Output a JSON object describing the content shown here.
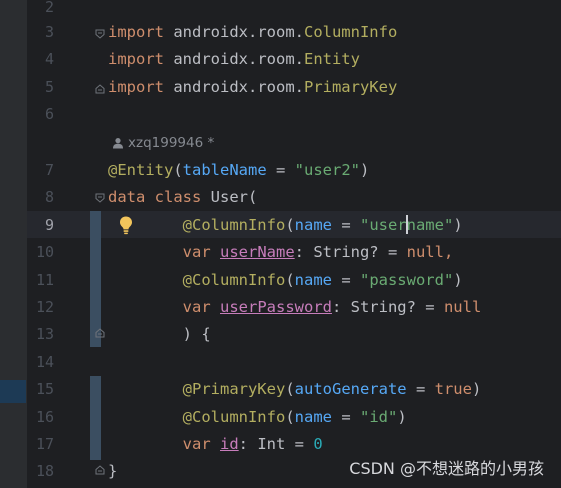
{
  "editor": {
    "author": "xzq199946 *",
    "lines": [
      {
        "number": "2",
        "tokens": []
      },
      {
        "number": "3",
        "tokens": [
          {
            "t": "import",
            "c": "kw"
          },
          {
            "t": " androidx.room."
          },
          {
            "t": "ColumnInfo",
            "c": "ann"
          }
        ]
      },
      {
        "number": "4",
        "tokens": [
          {
            "t": "import",
            "c": "kw"
          },
          {
            "t": " androidx.room."
          },
          {
            "t": "Entity",
            "c": "ann"
          }
        ]
      },
      {
        "number": "5",
        "tokens": [
          {
            "t": "import",
            "c": "kw"
          },
          {
            "t": " androidx.room."
          },
          {
            "t": "PrimaryKey",
            "c": "ann"
          }
        ]
      },
      {
        "number": "6",
        "tokens": []
      },
      {
        "number": "7",
        "tokens": [
          {
            "t": "@Entity",
            "c": "ann"
          },
          {
            "t": "("
          },
          {
            "t": "tableName",
            "c": "param"
          },
          {
            "t": " = "
          },
          {
            "t": "\"user2\"",
            "c": "str"
          },
          {
            "t": ")"
          }
        ]
      },
      {
        "number": "8",
        "tokens": [
          {
            "t": "data class",
            "c": "kw"
          },
          {
            "t": " User("
          }
        ]
      },
      {
        "number": "9",
        "tokens": [
          {
            "t": "        "
          },
          {
            "t": "@ColumnInfo",
            "c": "ann"
          },
          {
            "t": "("
          },
          {
            "t": "name",
            "c": "param"
          },
          {
            "t": " = "
          },
          {
            "t": "\"username\"",
            "c": "str"
          },
          {
            "t": ")"
          }
        ]
      },
      {
        "number": "10",
        "tokens": [
          {
            "t": "        "
          },
          {
            "t": "var",
            "c": "kw"
          },
          {
            "t": " "
          },
          {
            "t": "userName",
            "c": "prop"
          },
          {
            "t": ": String? = "
          },
          {
            "t": "null",
            "c": "kw"
          },
          {
            "t": ",",
            "c": "kw"
          }
        ]
      },
      {
        "number": "11",
        "tokens": [
          {
            "t": "        "
          },
          {
            "t": "@ColumnInfo",
            "c": "ann"
          },
          {
            "t": "("
          },
          {
            "t": "name",
            "c": "param"
          },
          {
            "t": " = "
          },
          {
            "t": "\"password\"",
            "c": "str"
          },
          {
            "t": ")"
          }
        ]
      },
      {
        "number": "12",
        "tokens": [
          {
            "t": "        "
          },
          {
            "t": "var",
            "c": "kw"
          },
          {
            "t": " "
          },
          {
            "t": "userPassword",
            "c": "prop"
          },
          {
            "t": ": String? = "
          },
          {
            "t": "null",
            "c": "kw"
          }
        ]
      },
      {
        "number": "13",
        "tokens": [
          {
            "t": "        ) {"
          }
        ]
      },
      {
        "number": "14",
        "tokens": []
      },
      {
        "number": "15",
        "tokens": [
          {
            "t": "        "
          },
          {
            "t": "@PrimaryKey",
            "c": "ann"
          },
          {
            "t": "("
          },
          {
            "t": "autoGenerate",
            "c": "param"
          },
          {
            "t": " = "
          },
          {
            "t": "true",
            "c": "kw"
          },
          {
            "t": ")"
          }
        ]
      },
      {
        "number": "16",
        "tokens": [
          {
            "t": "        "
          },
          {
            "t": "@ColumnInfo",
            "c": "ann"
          },
          {
            "t": "("
          },
          {
            "t": "name",
            "c": "param"
          },
          {
            "t": " = "
          },
          {
            "t": "\"id\"",
            "c": "str"
          },
          {
            "t": ")"
          }
        ]
      },
      {
        "number": "17",
        "tokens": [
          {
            "t": "        "
          },
          {
            "t": "var",
            "c": "kw"
          },
          {
            "t": " "
          },
          {
            "t": "id",
            "c": "prop"
          },
          {
            "t": ": Int = "
          },
          {
            "t": "0",
            "c": "num"
          }
        ]
      },
      {
        "number": "18",
        "tokens": [
          {
            "t": "}"
          }
        ]
      }
    ],
    "current_line": "9"
  },
  "watermark": "CSDN @不想迷路的小男孩",
  "colors": {
    "background": "#1e1f22",
    "keyword": "#cf8e6d",
    "annotation": "#b3ae60",
    "string": "#6aab73",
    "parameter": "#56a8f5",
    "property": "#c77dbb",
    "number": "#2aacb8",
    "text": "#bcbec4"
  },
  "icons": [
    "user-icon",
    "lightbulb-icon",
    "fold-marker-icon"
  ]
}
